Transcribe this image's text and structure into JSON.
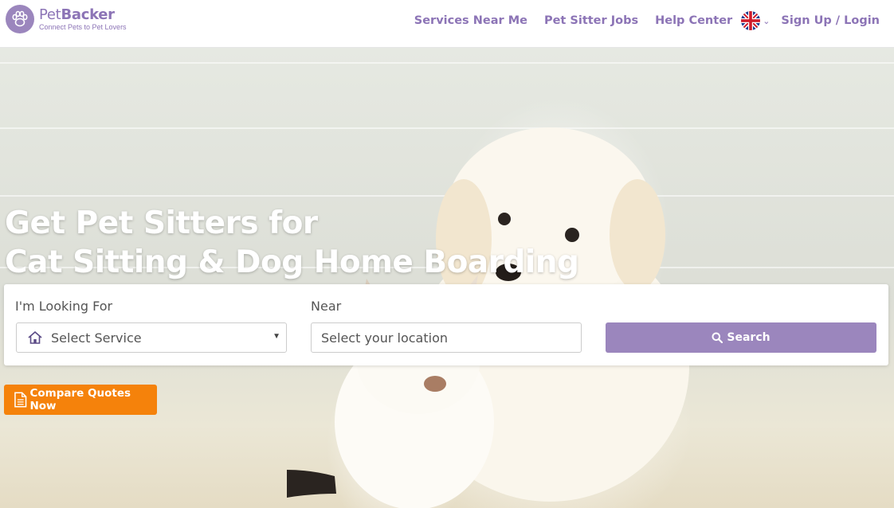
{
  "brand": {
    "name_bold": "Pet",
    "name_rest": "Backer",
    "tagline": "Connect Pets to Pet Lovers",
    "color": "#8c74b6"
  },
  "nav": {
    "items": [
      {
        "label": "Services Near Me"
      },
      {
        "label": "Pet Sitter Jobs"
      },
      {
        "label": "Help Center"
      }
    ],
    "language_icon": "uk-flag-icon",
    "login_label": "Sign Up / Login"
  },
  "hero": {
    "title_line1": "Get Pet Sitters for",
    "title_line2": "Cat Sitting & Dog Home Boarding"
  },
  "search": {
    "service_label": "I'm Looking For",
    "service_value": "Select Service",
    "service_icon": "home-icon",
    "near_label": "Near",
    "location_placeholder": "Select your location",
    "button_label": "Search",
    "button_icon": "search-icon",
    "accent": "#9b86bd"
  },
  "cta": {
    "label": "Compare Quotes Now",
    "icon": "document-icon",
    "color": "#f5820b"
  }
}
